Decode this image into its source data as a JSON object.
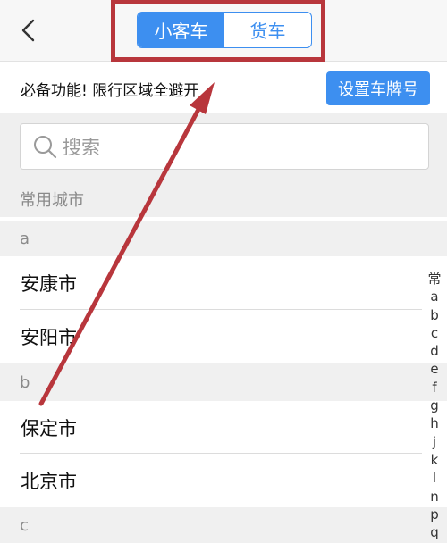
{
  "header": {
    "back_icon": "chevron-left-icon",
    "tabs": [
      {
        "label": "小客车",
        "active": true
      },
      {
        "label": "货车",
        "active": false
      }
    ]
  },
  "promo": {
    "text": "必备功能! 限行区域全避开",
    "button_label": "设置车牌号"
  },
  "search": {
    "placeholder": "搜索"
  },
  "list": {
    "common_cities_header": "常用城市",
    "sections": [
      {
        "letter": "a",
        "cities": [
          "安康市",
          "安阳市"
        ]
      },
      {
        "letter": "b",
        "cities": [
          "保定市",
          "北京市"
        ]
      },
      {
        "letter": "c",
        "cities": []
      }
    ]
  },
  "index_bar": [
    "常",
    "a",
    "b",
    "c",
    "d",
    "e",
    "f",
    "g",
    "h",
    "j",
    "k",
    "l",
    "n",
    "p",
    "q"
  ],
  "colors": {
    "accent": "#3d8ff0",
    "annotation": "#b8363c"
  }
}
